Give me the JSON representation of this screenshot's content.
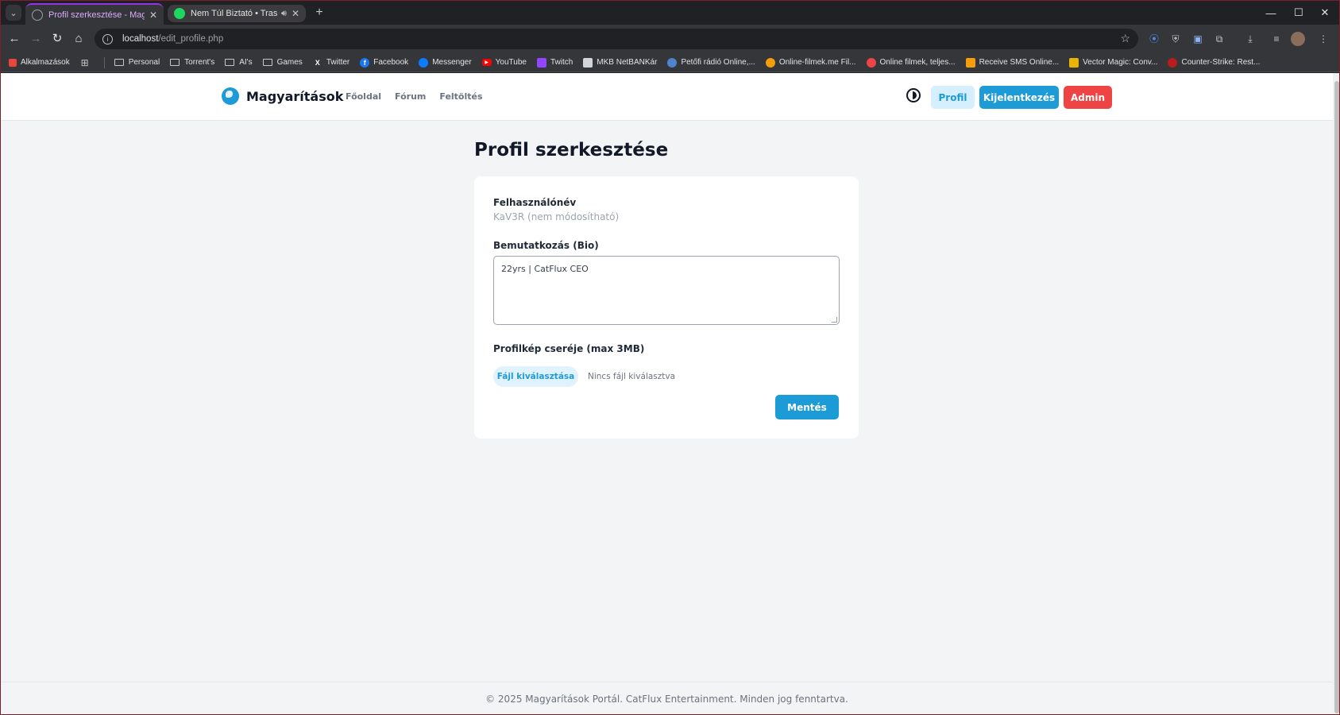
{
  "browser": {
    "tabs": [
      {
        "title": "Profil szerkesztése - Magyarítá...",
        "active": true
      },
      {
        "title": "Nem Túl Biztató • Trashkat",
        "active": false,
        "audio_icon": "speaker-icon"
      }
    ],
    "new_tab_label": "+",
    "window_controls": {
      "minimize": "—",
      "maximize": "☐",
      "close": "✕"
    },
    "address": {
      "host": "localhost",
      "path": "/edit_profile.php"
    },
    "bookmarks": [
      {
        "label": "Alkalmazások",
        "icon": "apps-grid-icon",
        "color": "#e8453c"
      },
      {
        "label": "Personal",
        "icon": "folder-icon"
      },
      {
        "label": "Torrent's",
        "icon": "folder-icon"
      },
      {
        "label": "AI's",
        "icon": "folder-icon"
      },
      {
        "label": "Games",
        "icon": "folder-icon"
      },
      {
        "label": "Twitter",
        "icon": "x-icon",
        "color": "#000000"
      },
      {
        "label": "Facebook",
        "icon": "facebook-icon",
        "color": "#1877f2"
      },
      {
        "label": "Messenger",
        "icon": "messenger-icon",
        "color": "#0a7cff"
      },
      {
        "label": "YouTube",
        "icon": "youtube-icon",
        "color": "#ff0000"
      },
      {
        "label": "Twitch",
        "icon": "twitch-icon",
        "color": "#9146ff"
      },
      {
        "label": "MKB NetBANKár",
        "icon": "bank-icon",
        "color": "#6b7280"
      },
      {
        "label": "Petőfi rádió Online,...",
        "icon": "radio-icon",
        "color": "#4f83cc"
      },
      {
        "label": "Online-filmek.me Fil...",
        "icon": "film-icon",
        "color": "#f59e0b"
      },
      {
        "label": "Online filmek, teljes...",
        "icon": "film-icon",
        "color": "#ef4444"
      },
      {
        "label": "Receive SMS Online...",
        "icon": "sms-icon",
        "color": "#f59e0b"
      },
      {
        "label": "Vector Magic: Conv...",
        "icon": "vector-magic-icon",
        "color": "#eab308"
      },
      {
        "label": "Counter-Strike: Rest...",
        "icon": "cs-icon",
        "color": "#b91c1c"
      }
    ]
  },
  "site": {
    "brand": "Magyarítások",
    "nav": [
      "Főoldal",
      "Fórum",
      "Feltöltés"
    ],
    "buttons": {
      "profile": "Profil",
      "logout": "Kijelentkezés",
      "admin": "Admin"
    },
    "colors": {
      "accent": "#1d9bd7",
      "danger": "#ef4444",
      "background": "#f3f4f6"
    }
  },
  "form": {
    "title": "Profil szerkesztése",
    "username_label": "Felhasználónév",
    "username_value": "KaV3R (nem módosítható)",
    "bio_label": "Bemutatkozás (Bio)",
    "bio_value": "22yrs | CatFlux CEO",
    "avatar_label": "Profilkép cseréje (max 3MB)",
    "file_button": "Fájl kiválasztása",
    "file_status": "Nincs fájl kiválasztva",
    "save_button": "Mentés"
  },
  "footer": "© 2025 Magyarítások Portál. CatFlux Entertainment. Minden jog fenntartva."
}
